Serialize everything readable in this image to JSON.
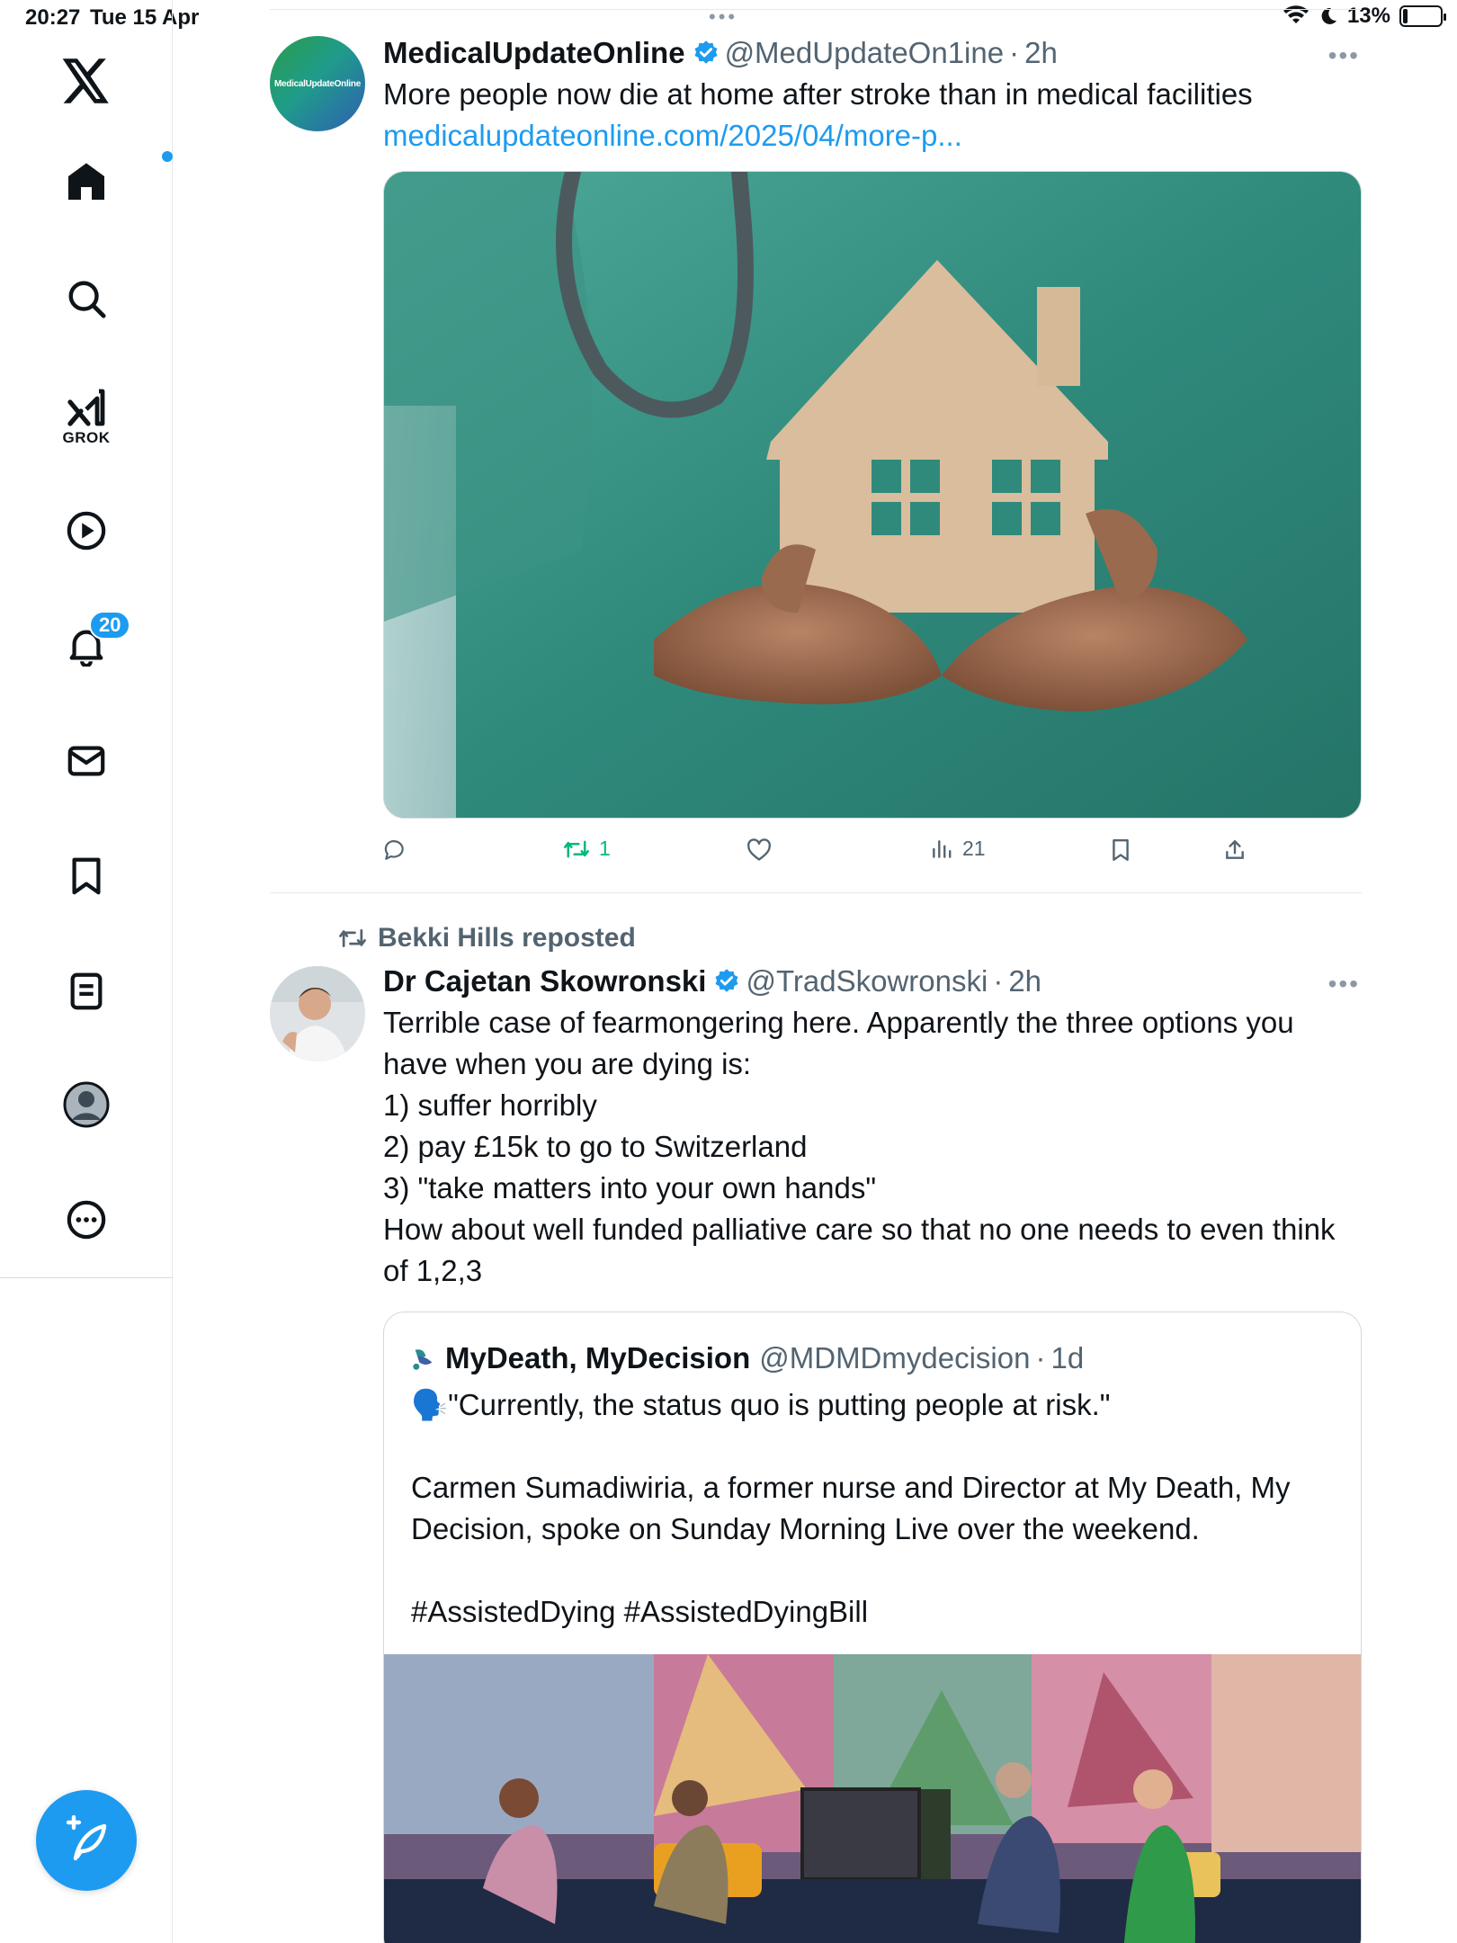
{
  "status_bar": {
    "time": "20:27",
    "date": "Tue 15 Apr",
    "battery": "13%",
    "battery_level": 0.13
  },
  "sidebar": {
    "grok_label": "GROK",
    "notifications_count": "20",
    "items": [
      "x-logo",
      "home",
      "search",
      "grok",
      "video",
      "notifications",
      "messages",
      "bookmarks",
      "lists",
      "profile",
      "more"
    ]
  },
  "feed": {
    "tweet1": {
      "avatar_text": "MedicalUpdateOnline",
      "name": "MedicalUpdateOnline",
      "handle": "@MedUpdateOn1ine",
      "separator": "·",
      "time": "2h",
      "text": "More people now die at home after stroke than in medical facilities",
      "link": "medicalupdateonline.com/2025/04/more-p...",
      "stats": {
        "retweets": "1",
        "views": "21"
      }
    },
    "tweet2": {
      "repost_label": "Bekki Hills reposted",
      "name": "Dr Cajetan Skowronski",
      "handle": "@TradSkowronski",
      "separator": "·",
      "time": "2h",
      "lines": [
        "Terrible case of fearmongering here. Apparently the three options you have when you are dying is:",
        "1) suffer horribly",
        "2) pay £15k to go to Switzerland",
        "3) \"take matters into your own hands\"",
        "How about well funded palliative care so that no one needs to even think of 1,2,3"
      ],
      "quote": {
        "name": "MyDeath, MyDecision",
        "handle": "@MDMDmydecision",
        "separator": "·",
        "time": "1d",
        "lines": [
          "🗣️\"Currently, the status quo is putting people at risk.\"",
          "",
          "Carmen Sumadiwiria, a former nurse and Director at My Death, My Decision, spoke on Sunday Morning Live over the weekend.",
          "",
          "#AssistedDying #AssistedDyingBill"
        ]
      }
    }
  },
  "colors": {
    "accent": "#1d9bf0",
    "retweet_green": "#00ba7c",
    "secondary_text": "#536471"
  }
}
